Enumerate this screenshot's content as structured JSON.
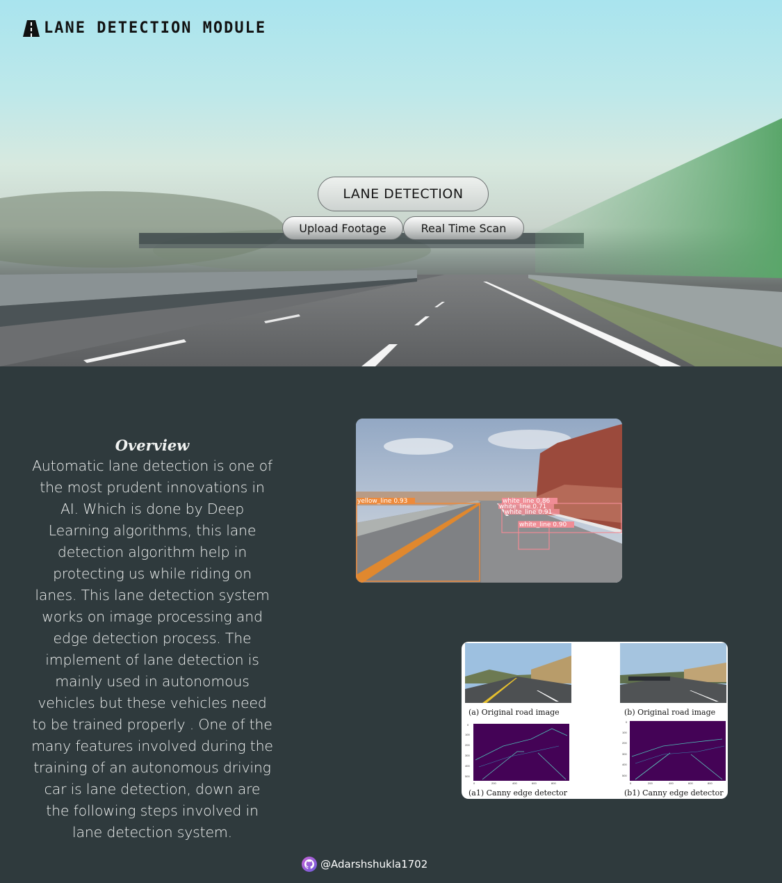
{
  "header": {
    "title": "Lane Detection Module",
    "logo_icon": "road-icon"
  },
  "hero": {
    "title_button": "LANE DETECTION",
    "upload_button": "Upload Footage",
    "scan_button": "Real Time Scan"
  },
  "overview": {
    "heading": "Overview",
    "body": "Automatic lane detection is one of the most prudent innovations in AI. Which is done by Deep Learning algorithms, this lane detection algorithm help in protecting us while riding on lanes. This lane detection system works on image processing and edge detection process. The implement of lane detection is mainly used in autonomous vehicles but these vehicles need to be trained properly . One of the many features involved during the training of an autonomous driving car is lane detection, down are the following steps involved in lane detection system."
  },
  "detection_image": {
    "labels": [
      "yellow_line 0.93",
      "white_line 0.86",
      "white_line 0.71",
      "white_line 0.91",
      "white_line 0.90"
    ]
  },
  "canny_figure": {
    "captions": [
      "(a) Original road image",
      "(b) Original road image",
      "(a1) Canny edge detector",
      "(b1) Canny edge detector"
    ],
    "y_ticks": [
      "0",
      "100",
      "200",
      "300",
      "400",
      "500"
    ],
    "x_ticks": [
      "0",
      "200",
      "400",
      "600",
      "800"
    ]
  },
  "footer": {
    "handle": "@Adarshshukla1702",
    "icon": "github-icon"
  }
}
